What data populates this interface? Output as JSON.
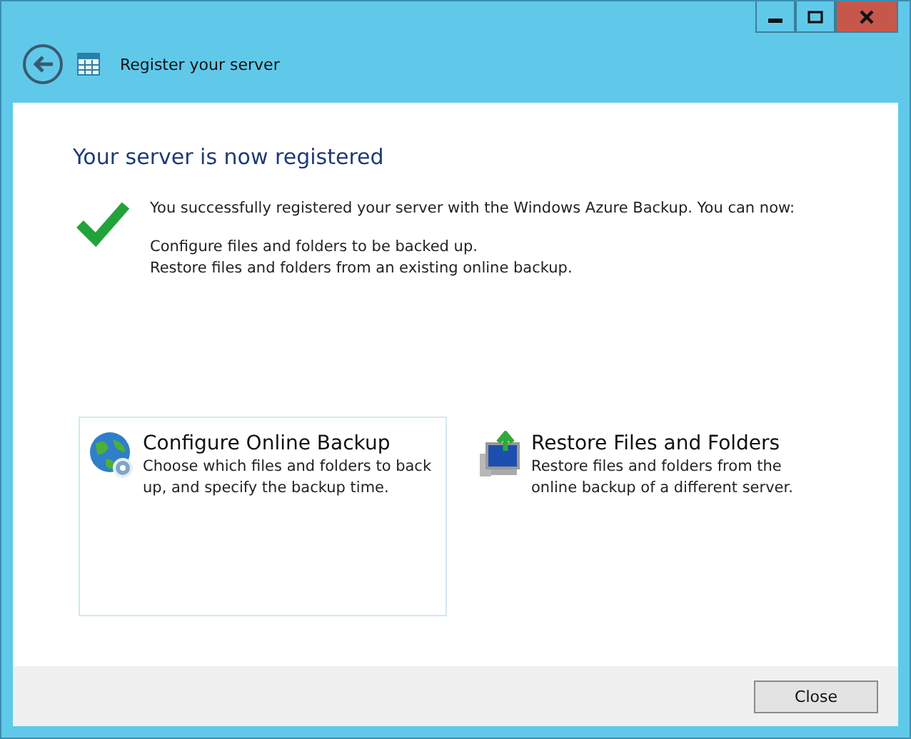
{
  "window": {
    "title": "Register your server"
  },
  "heading": "Your server is now registered",
  "message": {
    "intro": "You successfully registered your server with the Windows Azure Backup. You can now:",
    "lines": [
      "Configure files and folders to be backed up.",
      "Restore files and folders from an existing online backup."
    ]
  },
  "options": [
    {
      "kind": "globe",
      "title": "Configure Online Backup",
      "description": "Choose which files and folders to back up, and specify the backup time.",
      "selected": true
    },
    {
      "kind": "monitor",
      "title": "Restore Files and Folders",
      "description": "Restore files and folders from the online backup of a different server.",
      "selected": false
    }
  ],
  "buttons": [
    "Close"
  ]
}
